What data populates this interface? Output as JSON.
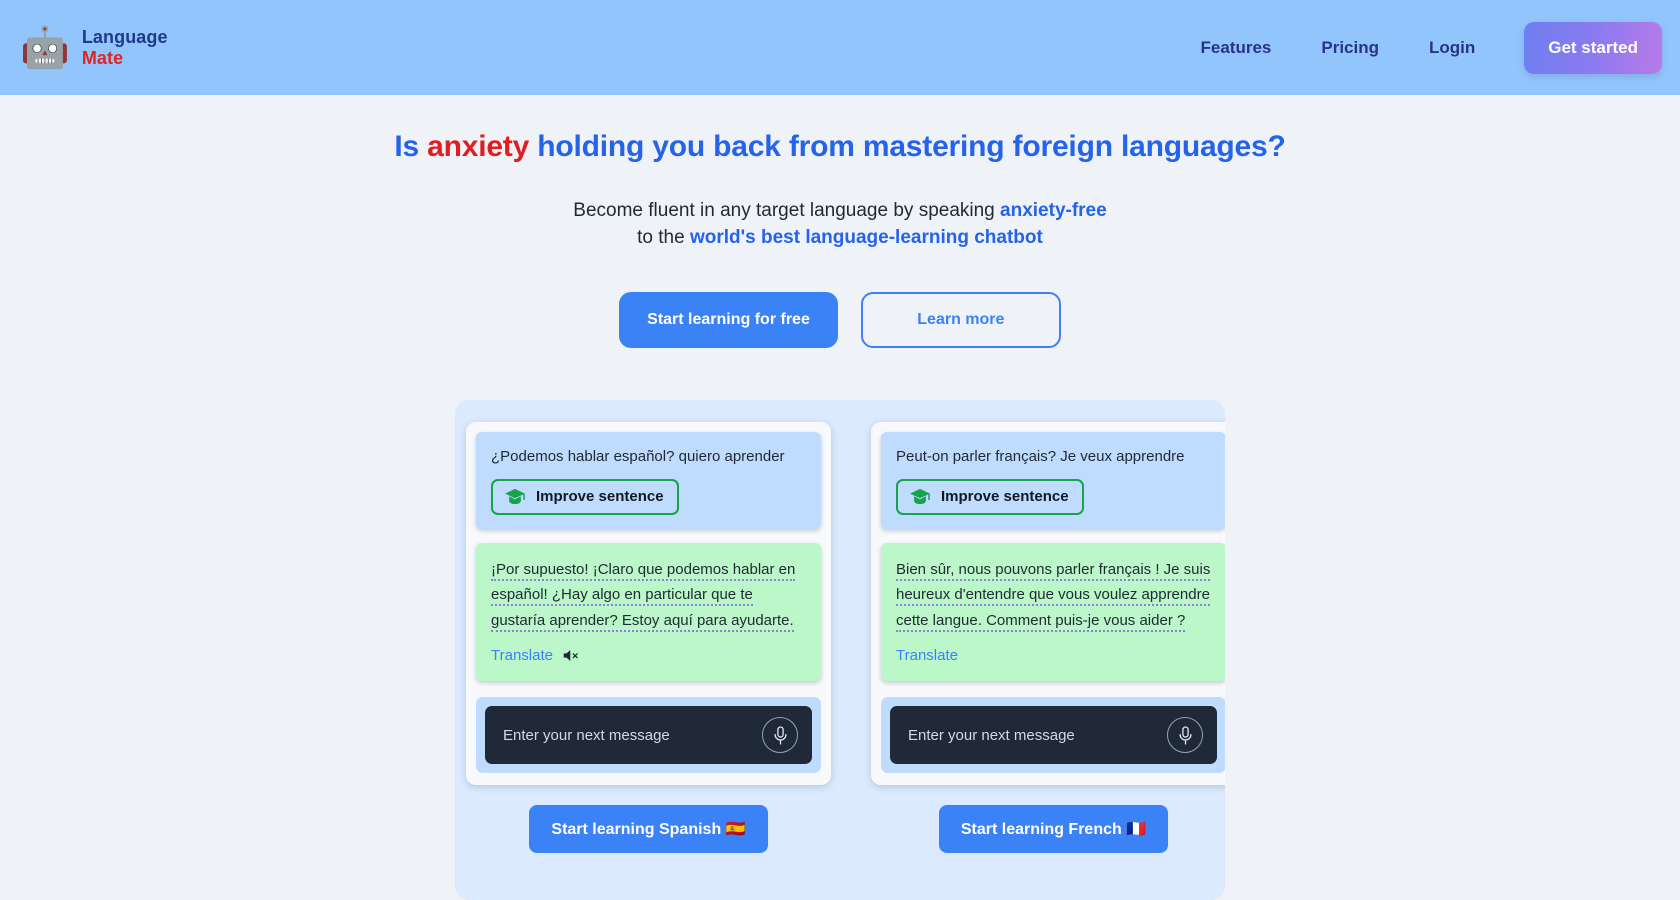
{
  "navbar": {
    "logo_icon": "robot-icon",
    "brand_line1": "Language",
    "brand_line2": "Mate",
    "links": [
      {
        "label": "Features"
      },
      {
        "label": "Pricing"
      },
      {
        "label": "Login"
      }
    ],
    "cta_label": "Get started",
    "background_color": "#93c5fd",
    "cta_gradient_from": "#6d7ff0",
    "cta_gradient_to": "#b97ae8"
  },
  "hero": {
    "headline_part1": "Is ",
    "headline_accent": "anxiety",
    "headline_part2": " holding you back from mastering foreign languages?",
    "headline_color": "#2563eb",
    "headline_accent_color": "#e11d20",
    "sub_line1_part1": "Become fluent in any target language by speaking ",
    "sub_line1_highlight": "anxiety-free",
    "sub_line2_part1": "to the ",
    "sub_line2_highlight": "world's best language-learning chatbot",
    "primary_button": "Start learning for free",
    "secondary_button": "Learn more",
    "primary_color": "#3b82f6"
  },
  "carousel": {
    "background_color": "#dbeafe",
    "cards": [
      {
        "user_message": "¿Podemos hablar español? quiero aprender",
        "improve_label": "Improve sentence",
        "improve_icon": "graduation-cap-icon",
        "improve_border_color": "#16a34a",
        "bot_message": "¡Por supuesto! ¡Claro que podemos hablar en español! ¿Hay algo en particular que te gustaría aprender? Estoy aquí para ayudarte.",
        "translate_label": "Translate",
        "mute_icon": "speaker-mute-icon",
        "has_mute_icon": true,
        "composer_placeholder": "Enter your next message",
        "mic_icon": "microphone-icon",
        "start_button": "Start learning Spanish 🇪🇸"
      },
      {
        "user_message": "Peut-on parler français? Je veux apprendre",
        "improve_label": "Improve sentence",
        "improve_icon": "graduation-cap-icon",
        "improve_border_color": "#16a34a",
        "bot_message": "Bien sûr, nous pouvons parler français ! Je suis heureux d'entendre que vous voulez apprendre cette langue. Comment puis-je vous aider ?",
        "translate_label": "Translate",
        "mute_icon": "speaker-mute-icon",
        "has_mute_icon": false,
        "composer_placeholder": "Enter your next message",
        "mic_icon": "microphone-icon",
        "start_button": "Start learning French 🇫🇷"
      }
    ]
  }
}
